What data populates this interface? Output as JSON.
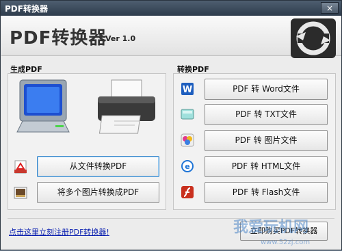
{
  "window": {
    "title": "PDF转换器",
    "close_glyph": "×"
  },
  "header": {
    "app_title": "PDF转换器",
    "version": "Ver 1.0",
    "logo_icon": "refresh-arrows-icon"
  },
  "left_section": {
    "label": "生成PDF",
    "buttons": {
      "from_file": "从文件转换PDF",
      "multi_images": "将多个图片转换成PDF"
    }
  },
  "right_section": {
    "label": "转换PDF",
    "buttons": {
      "word": "PDF 转 Word文件",
      "txt": "PDF 转 TXT文件",
      "image": "PDF 转 图片文件",
      "html": "PDF 转 HTML文件",
      "flash": "PDF 转 Flash文件"
    }
  },
  "footer": {
    "register_link": "点击这里立刻注册PDF转换器!",
    "register_button": "立即购买PDF转换器"
  },
  "watermark": {
    "text": "我爱玩机网",
    "url": "www.52zj.com"
  },
  "colors": {
    "titlebar": "#3e4c5c",
    "link": "#0a1fb0",
    "focus_border": "#3a86c8"
  }
}
